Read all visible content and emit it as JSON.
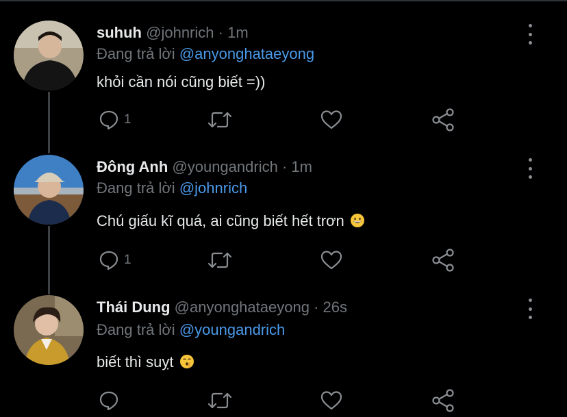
{
  "tweets": [
    {
      "name": "suhuh",
      "handle": "@johnrich",
      "sep": "·",
      "time": "1m",
      "reply_prefix": "Đang trả lời",
      "reply_to": "@anyonghataeyong",
      "text": "khỏi cần nói cũng biết =))",
      "text_emoji": "",
      "reply_count": "1"
    },
    {
      "name": "Đông Anh",
      "handle": "@youngandrich",
      "sep": "·",
      "time": "1m",
      "reply_prefix": "Đang trả lời",
      "reply_to": "@johnrich",
      "text": "Chú giấu kĩ quá, ai cũng biết hết trơn",
      "text_emoji": "grinning-face-emoji",
      "reply_count": "1"
    },
    {
      "name": "Thái Dung",
      "handle": "@anyonghataeyong",
      "sep": "·",
      "time": "26s",
      "reply_prefix": "Đang trả lời",
      "reply_to": "@youngandrich",
      "text": "biết thì suỵt",
      "text_emoji": "shushing-face-emoji",
      "reply_count": ""
    }
  ],
  "icons": [
    "reply-icon",
    "retweet-icon",
    "like-icon",
    "share-icon",
    "more-icon"
  ],
  "colors": {
    "background": "#000000",
    "mention": "#4a99e9",
    "muted": "#71767b",
    "text": "#e7e9ea"
  }
}
